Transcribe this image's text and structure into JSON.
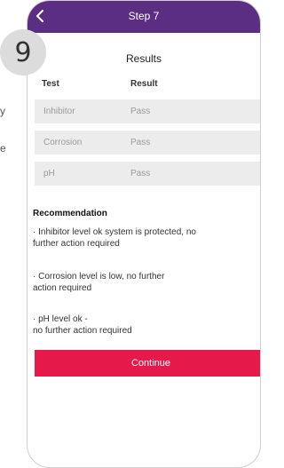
{
  "left_edge": {
    "line1": "y",
    "line2": "e"
  },
  "step_badge": "9",
  "header": {
    "title": "Step 7",
    "back_icon": "chevron-left-icon"
  },
  "colors": {
    "header": "#5b2e83",
    "continue": "#e5194a",
    "row_bg": "#ececec"
  },
  "results": {
    "title": "Results",
    "columns": [
      "Test",
      "Result"
    ],
    "rows": [
      {
        "test": "Inhibitor",
        "result": "Pass"
      },
      {
        "test": "Corrosion",
        "result": "Pass"
      },
      {
        "test": "pH",
        "result": "Pass"
      }
    ]
  },
  "recommendation": {
    "heading": "Recommendation",
    "items": [
      "· Inhibitor level ok system is protected, no\nfurther action required",
      "· Corrosion level is low, no further\naction required",
      "· pH level ok -\nno further action required"
    ]
  },
  "continue_label": "Continue"
}
